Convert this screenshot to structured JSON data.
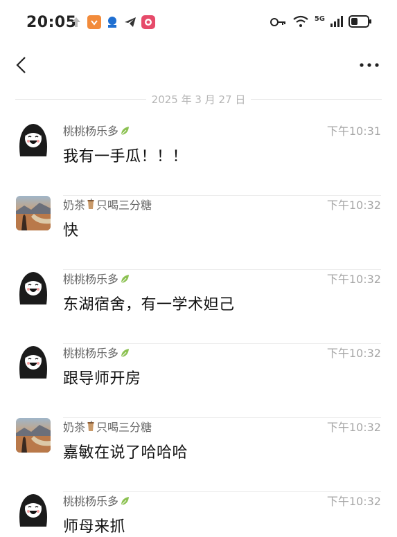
{
  "status_bar": {
    "time": "20:05",
    "network_label": "5G"
  },
  "colors": {
    "accent_leaf": "#8cc152",
    "timestamp": "#a6a6a6",
    "sender": "#666666"
  },
  "date_divider": "2025 年 3 月 27 日",
  "messages": [
    {
      "sender": "桃桃杨乐多",
      "badge": "leaf-icon",
      "time": "下午10:31",
      "text": "我有一手瓜！！！",
      "avatar": "girl"
    },
    {
      "sender": "奶茶",
      "badge_before": "cup-icon",
      "sender_suffix": "只喝三分糖",
      "time": "下午10:32",
      "text": "快",
      "avatar": "scenic"
    },
    {
      "sender": "桃桃杨乐多",
      "badge": "leaf-icon",
      "time": "下午10:32",
      "text": "东湖宿舍，有一学术妲己",
      "avatar": "girl"
    },
    {
      "sender": "桃桃杨乐多",
      "badge": "leaf-icon",
      "time": "下午10:32",
      "text": "跟导师开房",
      "avatar": "girl"
    },
    {
      "sender": "奶茶",
      "badge_before": "cup-icon",
      "sender_suffix": "只喝三分糖",
      "time": "下午10:32",
      "text": "嘉敏在说了哈哈哈",
      "avatar": "scenic"
    },
    {
      "sender": "桃桃杨乐多",
      "badge": "leaf-icon",
      "time": "下午10:32",
      "text": "师母来抓",
      "avatar": "girl"
    }
  ]
}
